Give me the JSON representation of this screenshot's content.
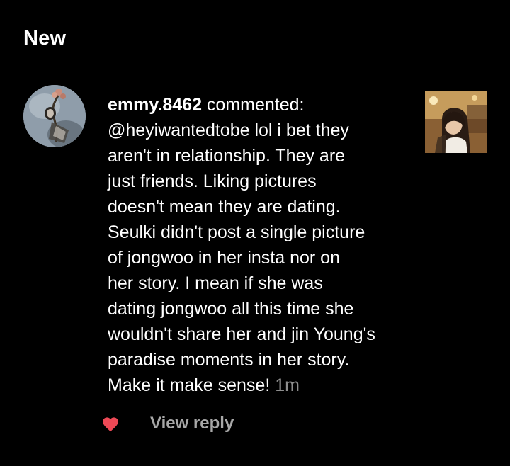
{
  "section": {
    "title": "New"
  },
  "notification": {
    "username": "emmy.8462",
    "action": " commented:",
    "mention": "@heyiwantedtobe",
    "comment_text": " lol i bet they\naren't in relationship. They are\njust friends. Liking pictures\ndoesn't mean they are dating.\nSeulki didn't post a single picture\nof jongwoo in her insta nor on\nher story. I mean if she was\ndating jongwoo all this time she\nwouldn't share her and jin Young's\nparadise moments in her story.\nMake it make sense!",
    "timestamp": "1m",
    "avatar_icon": "profile-avatar",
    "post_thumbnail_icon": "post-thumbnail"
  },
  "actions": {
    "like_icon": "heart-filled",
    "like_color": "#ed4956",
    "view_reply_label": "View reply"
  },
  "colors": {
    "background": "#000000",
    "text_primary": "#ffffff",
    "text_secondary": "#8e8e8e",
    "view_reply": "#a8a8a8"
  }
}
